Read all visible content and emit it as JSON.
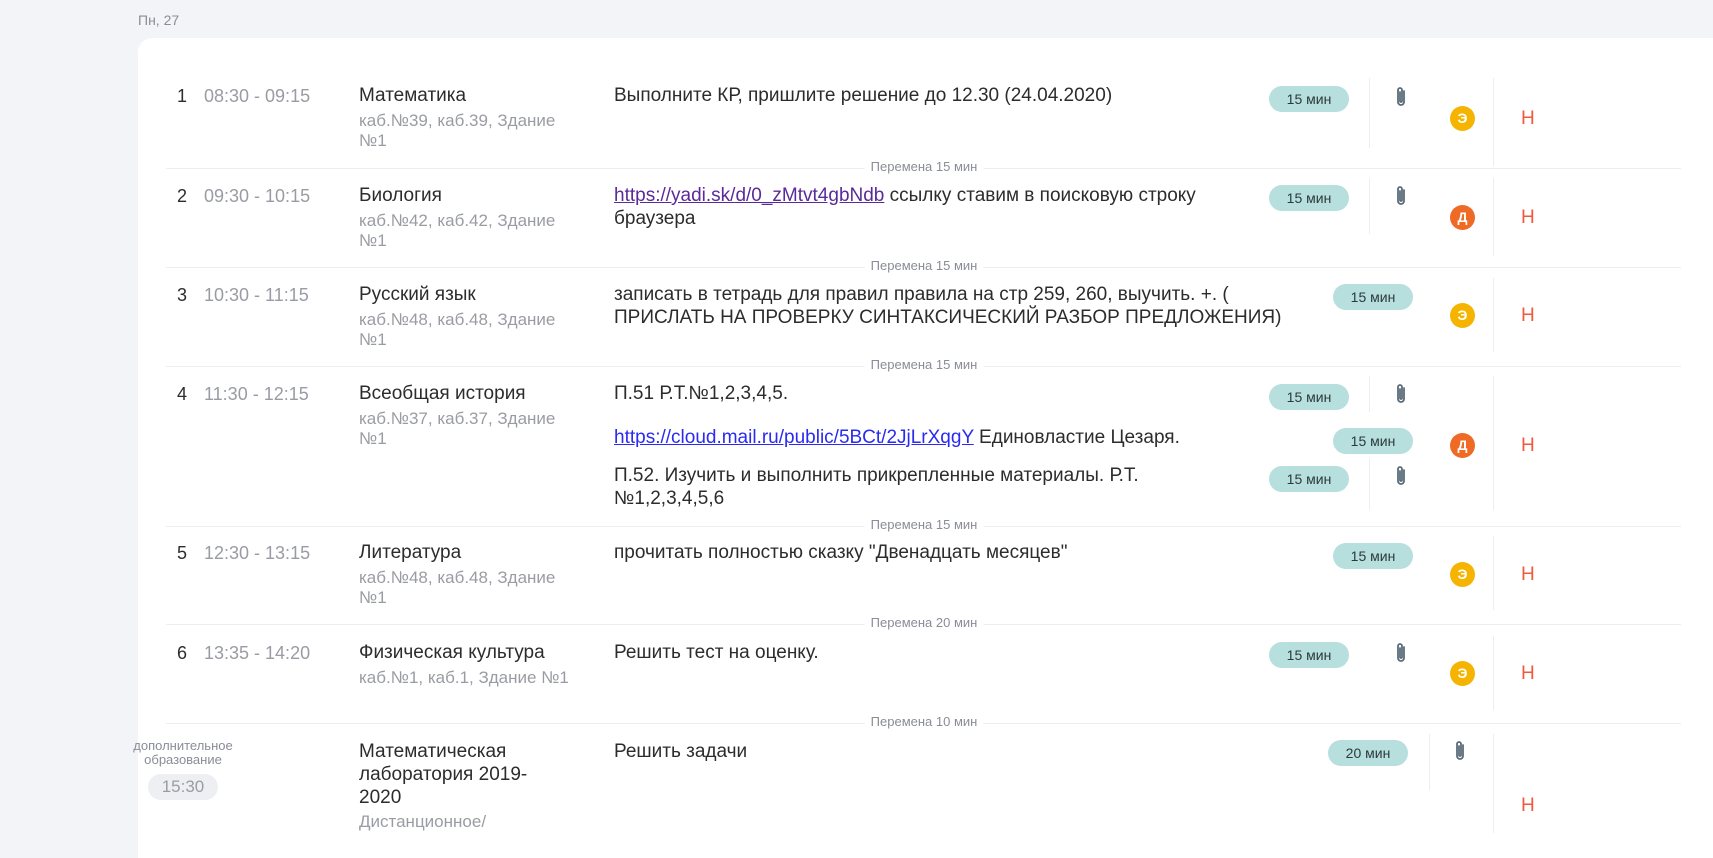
{
  "date_label": "Пн, 27",
  "lessons": [
    {
      "number": "1",
      "time": "08:30 - 09:15",
      "subject": "Математика",
      "room": "каб.№39, каб.39, Здание №1",
      "tasks": [
        {
          "text": "Выполните КР, пришлите решение до 12.30 (24.04.2020)",
          "duration": "15 мин"
        }
      ],
      "badge": "Э",
      "mark": "Н"
    },
    {
      "number": "2",
      "time": "09:30 - 10:15",
      "subject": "Биология",
      "room": "каб.№42, каб.42, Здание №1",
      "tasks": [
        {
          "link": "https://yadi.sk/d/0_zMtvt4gbNdb",
          "text": " ссылку ставим в поисковую строку браузера",
          "duration": "15 мин"
        }
      ],
      "badge": "Д",
      "mark": "Н"
    },
    {
      "number": "3",
      "time": "10:30 - 11:15",
      "subject": "Русский язык",
      "room": "каб.№48, каб.48, Здание №1",
      "tasks": [
        {
          "text": "записать в тетрадь для правил правила на стр 259, 260, выучить. +. ( ПРИСЛАТЬ НА ПРОВЕРКУ СИНТАКСИЧЕСКИЙ РАЗБОР ПРЕДЛОЖЕНИЯ)",
          "duration": "15 мин"
        }
      ],
      "badge": "Э",
      "mark": "Н"
    },
    {
      "number": "4",
      "time": "11:30 - 12:15",
      "subject": "Всеобщая история",
      "room": "каб.№37, каб.37, Здание №1",
      "tasks": [
        {
          "text": "П.51 Р.Т.№1,2,3,4,5.",
          "duration": "15 мин"
        },
        {
          "link": "https://cloud.mail.ru/public/5BCt/2JjLrXqgY",
          "text": " Единовластие Цезаря.",
          "duration": "15 мин"
        },
        {
          "text": "П.52. Изучить и выполнить прикрепленные материалы. Р.Т. №1,2,3,4,5,6",
          "duration": "15 мин"
        }
      ],
      "badge": "Д",
      "mark": "Н"
    },
    {
      "number": "5",
      "time": "12:30 - 13:15",
      "subject": "Литература",
      "room": "каб.№48, каб.48, Здание №1",
      "tasks": [
        {
          "text": "прочитать полностью сказку \"Двенадцать месяцев\"",
          "duration": "15 мин"
        }
      ],
      "badge": "Э",
      "mark": "Н"
    },
    {
      "number": "6",
      "time": "13:35 - 14:20",
      "subject": "Физическая культура",
      "room": "каб.№1, каб.1, Здание №1",
      "tasks": [
        {
          "text": "Решить тест на оценку.",
          "duration": "15 мин"
        }
      ],
      "badge": "Э",
      "mark": "Н"
    }
  ],
  "breaks": [
    "Перемена 15 мин",
    "Перемена 15 мин",
    "Перемена 15 мин",
    "Перемена 15 мин",
    "Перемена 20 мин",
    "Перемена 10 мин"
  ],
  "extra": {
    "label_line1": "дополнительное",
    "label_line2": "образование",
    "time": "15:30",
    "subject": "Математическая лаборатория 2019-2020",
    "room": "Дистанционное/",
    "task": "Решить задачи",
    "duration": "20 мин",
    "mark": "Н"
  },
  "colors": {
    "pill": "#b6dfdd",
    "badge_e": "#f5b400",
    "badge_d": "#ee6a25",
    "mark": "#f0593e"
  },
  "icons": {
    "attachment": "paperclip-icon"
  }
}
